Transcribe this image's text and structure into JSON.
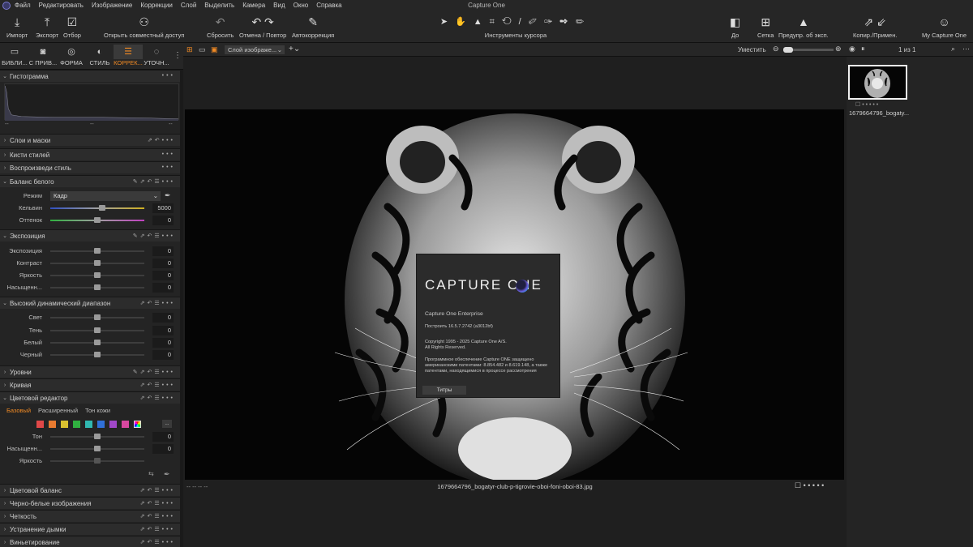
{
  "app": {
    "title": "Capture One"
  },
  "menu": [
    "Файл",
    "Редактировать",
    "Изображение",
    "Коррекции",
    "Слой",
    "Выделить",
    "Камера",
    "Вид",
    "Окно",
    "Справка"
  ],
  "toolbar": {
    "import": "Импорт",
    "export": "Экспорт",
    "select": "Отбор",
    "share": "Открыть совместный доступ",
    "reset": "Сбросить",
    "undo_redo": "Отмена / Повтор",
    "auto": "Автокоррекция",
    "cursor_tools": "Инструменты курсора",
    "before": "До",
    "grid": "Сетка",
    "exposure_warn": "Предупр. об эксп.",
    "copy_apply": "Копир./Примен.",
    "account": "My Capture One"
  },
  "tool_tabs": [
    {
      "label": "БИБЛИ..."
    },
    {
      "label": "С ПРИВ..."
    },
    {
      "label": "ФОРМА"
    },
    {
      "label": "СТИЛЬ"
    },
    {
      "label": "КОРРЕК..."
    },
    {
      "label": "УТОЧН..."
    }
  ],
  "histogram": {
    "title": "Гистограмма",
    "ticks": [
      "--",
      "--",
      "--"
    ]
  },
  "sections": {
    "layers": "Слои и маски",
    "brushes": "Кисти стилей",
    "replay": "Воспроизведи стиль",
    "wb": "Баланс белого",
    "exposure": "Экспозиция",
    "hdr": "Высокий динамический диапазон",
    "levels": "Уровни",
    "curve": "Кривая",
    "color_editor": "Цветовой редактор",
    "color_balance": "Цветовой баланс",
    "bw": "Черно-белые изображения",
    "clarity": "Четкость",
    "dehaze": "Устранение дымки",
    "vignette": "Виньетирование"
  },
  "white_balance": {
    "mode_label": "Режим",
    "mode_value": "Кадр",
    "kelvin_label": "Кельвин",
    "kelvin_value": "5000",
    "tint_label": "Оттенок",
    "tint_value": "0"
  },
  "exposure": [
    {
      "label": "Экспозиция",
      "value": "0"
    },
    {
      "label": "Контраст",
      "value": "0"
    },
    {
      "label": "Яркость",
      "value": "0"
    },
    {
      "label": "Насыщенн...",
      "value": "0"
    }
  ],
  "hdr": [
    {
      "label": "Свет",
      "value": "0"
    },
    {
      "label": "Тень",
      "value": "0"
    },
    {
      "label": "Белый",
      "value": "0"
    },
    {
      "label": "Черный",
      "value": "0"
    }
  ],
  "color_editor": {
    "tabs": [
      "Базовый",
      "Расширенный",
      "Тон кожи"
    ],
    "swatches": [
      "#e04848",
      "#e87a30",
      "#d8c030",
      "#30b040",
      "#30b8b0",
      "#3070d8",
      "#a048c8",
      "#d848a0"
    ],
    "rows": [
      {
        "label": "Тон",
        "value": "0"
      },
      {
        "label": "Насыщенн...",
        "value": "0"
      },
      {
        "label": "Яркость",
        "value": ""
      }
    ]
  },
  "viewer": {
    "layer_select": "Слой изображе...",
    "fit_label": "Уместить",
    "filename": "1679664796_bogatyr-club-p-tigrovie-oboi-foni-oboi-83.jpg",
    "footer_left": "--   --   --   --"
  },
  "about": {
    "brand": "CAPTURE ONE",
    "product": "Capture One Enterprise",
    "build": "Построить 16.5.7.2742 (a3012bf)",
    "copyright1": "Copyright 1995 - 2025 Capture One A/S.",
    "copyright2": "All Rights Reserved.",
    "patents": "Программное обеспечение Capture ONE защищено американскими патентами: 8.854.482 и 8.619.148, а также патентами, находящимися в процессе рассмотрения",
    "credits_button": "Титры"
  },
  "browser": {
    "counter": "1 из 1",
    "thumb_label": "1679664796_bogaty..."
  },
  "colors": {
    "accent": "#f08a24",
    "panel": "#242424",
    "bg": "#1e1e1e"
  }
}
